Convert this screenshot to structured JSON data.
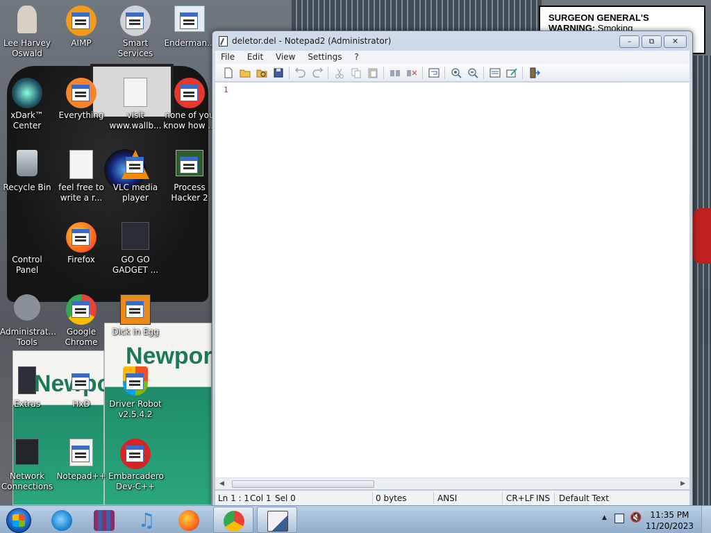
{
  "desktop": {
    "warning_bold": "SURGEON GENERAL'S WARNING:",
    "warning_rest": "Smoking",
    "pack_brand": "Newport",
    "icons": [
      {
        "label": "Lee Harvey Oswald"
      },
      {
        "label": "AIMP"
      },
      {
        "label": "Smart Services"
      },
      {
        "label": "Enderman..."
      },
      {
        "label": "xDark™ Center"
      },
      {
        "label": "Everything"
      },
      {
        "label": "visit www.wallb..."
      },
      {
        "label": "none of you know how ..."
      },
      {
        "label": "Recycle Bin"
      },
      {
        "label": "feel free to write a r..."
      },
      {
        "label": "VLC media player"
      },
      {
        "label": "Process Hacker 2"
      },
      {
        "label": "Control Panel"
      },
      {
        "label": "Firefox"
      },
      {
        "label": "GO GO GADGET ..."
      },
      {
        "label": "Administrat... Tools"
      },
      {
        "label": "Google Chrome"
      },
      {
        "label": "Dick in Egg"
      },
      {
        "label": "Extras"
      },
      {
        "label": "HxD"
      },
      {
        "label": "Driver Robot v2.5.4.2"
      },
      {
        "label": "Network Connections"
      },
      {
        "label": "Notepad++"
      },
      {
        "label": "Embarcadero Dev-C++"
      }
    ]
  },
  "window": {
    "title": "deletor.del - Notepad2 (Administrator)",
    "menu": [
      "File",
      "Edit",
      "View",
      "Settings",
      "?"
    ],
    "editor": {
      "line_number": "1",
      "content": ""
    },
    "status": {
      "ln": "Ln 1 : 1",
      "col": "Col 1",
      "sel": "Sel 0",
      "size": "0 bytes",
      "encoding": "ANSI",
      "eol": "CR+LF",
      "mode": "INS",
      "scheme": "Default Text"
    }
  },
  "taskbar": {
    "apps": [
      {
        "name": "internet-explorer-icon",
        "color": "#1e88d4"
      },
      {
        "name": "winrar-icon",
        "color": "#8a2e6a"
      },
      {
        "name": "itunes-icon",
        "color": "#2a8fe0"
      },
      {
        "name": "firefox-icon",
        "color": "#ff7a1a"
      },
      {
        "name": "chrome-icon",
        "color": "#34a853"
      },
      {
        "name": "notepad2-icon",
        "color": "#3a5f94"
      }
    ],
    "clock": {
      "time": "11:35 PM",
      "date": "11/20/2023"
    }
  }
}
